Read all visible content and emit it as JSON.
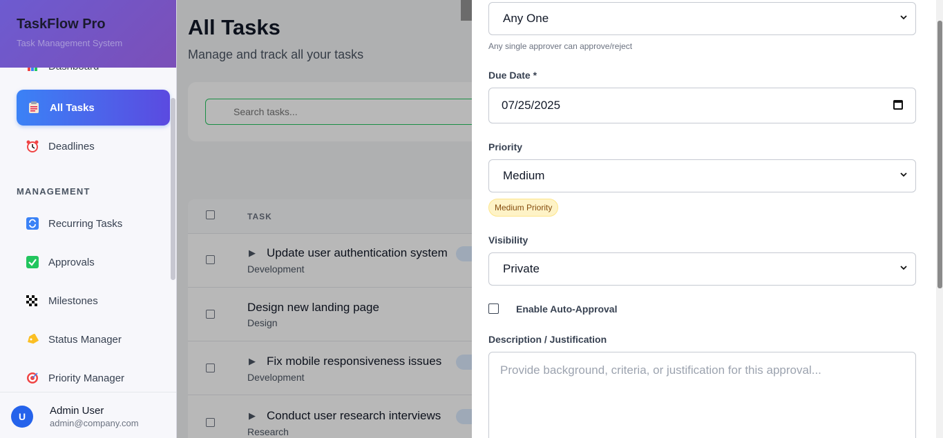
{
  "app": {
    "name": "TaskFlow Pro",
    "tagline": "Task Management System"
  },
  "sidebar": {
    "items_top": [
      {
        "label": "Dashboard",
        "icon": "bar-chart-icon"
      },
      {
        "label": "All Tasks",
        "icon": "clipboard-icon",
        "active": true
      },
      {
        "label": "Deadlines",
        "icon": "alarm-clock-icon"
      }
    ],
    "section": "MANAGEMENT",
    "items_mgmt": [
      {
        "label": "Recurring Tasks",
        "icon": "repeat-icon"
      },
      {
        "label": "Approvals",
        "icon": "check-mark-icon"
      },
      {
        "label": "Milestones",
        "icon": "checkered-flag-icon"
      },
      {
        "label": "Status Manager",
        "icon": "tag-icon"
      },
      {
        "label": "Priority Manager",
        "icon": "target-icon"
      }
    ],
    "user": {
      "initial": "U",
      "name": "Admin User",
      "email": "admin@company.com"
    }
  },
  "main": {
    "title": "All Tasks",
    "subtitle": "Manage and track all your tasks",
    "search_placeholder": "Search tasks...",
    "table": {
      "header_task": "TASK",
      "rows": [
        {
          "title": "Update user authentication system",
          "category": "Development",
          "expandable": true
        },
        {
          "title": "Design new landing page",
          "category": "Design",
          "expandable": false
        },
        {
          "title": "Fix mobile responsiveness issues",
          "category": "Development",
          "expandable": true
        },
        {
          "title": "Conduct user research interviews",
          "category": "Research",
          "expandable": true
        }
      ]
    }
  },
  "panel": {
    "approval_mode": {
      "value": "Any One",
      "help": "Any single approver can approve/reject"
    },
    "due_date": {
      "label": "Due Date *",
      "value": "07/25/2025"
    },
    "priority": {
      "label": "Priority",
      "value": "Medium",
      "badge": "Medium Priority"
    },
    "visibility": {
      "label": "Visibility",
      "value": "Private"
    },
    "auto_approval": {
      "label": "Enable Auto-Approval",
      "checked": false
    },
    "description": {
      "label": "Description / Justification",
      "placeholder": "Provide background, criteria, or justification for this approval..."
    }
  },
  "colors": {
    "accent": "#3b82f6",
    "accent2": "#5b4ae0",
    "brand_bg": "#6d5bd0",
    "badge_bg": "#fef3c7"
  }
}
